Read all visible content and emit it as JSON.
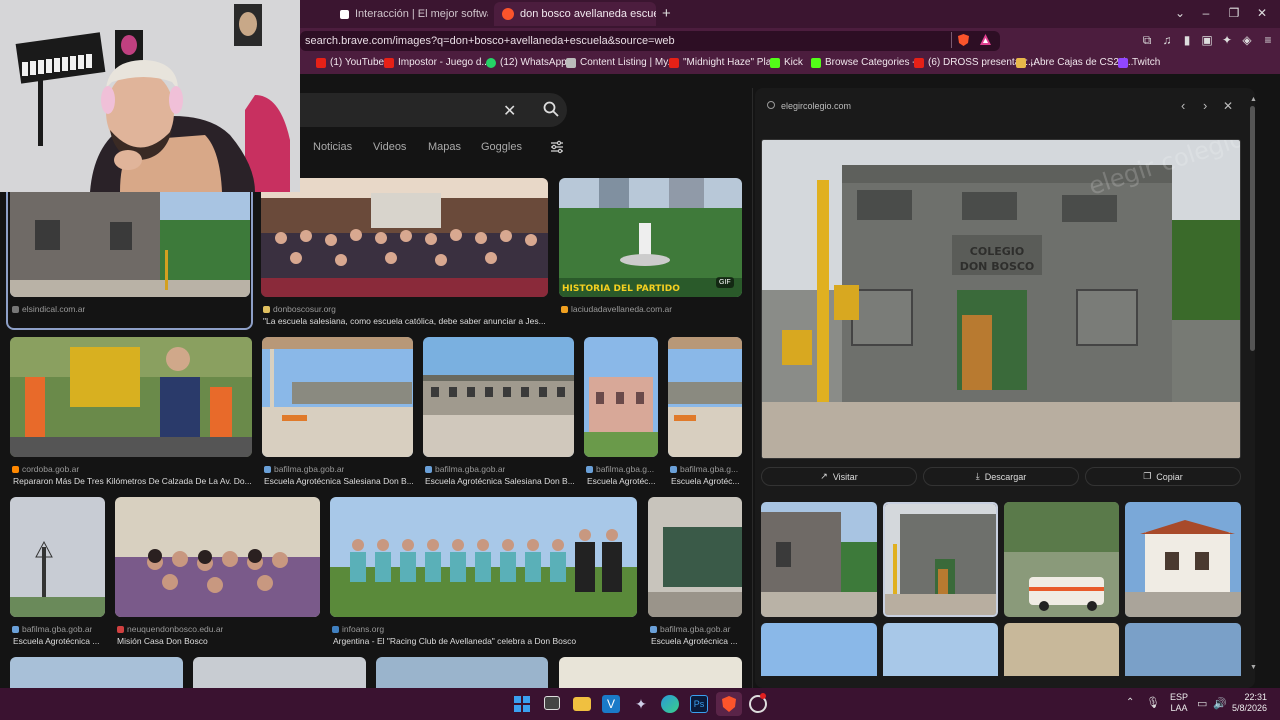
{
  "tabs": [
    {
      "title": "Interacción | El mejor software pa"
    },
    {
      "title": "don bosco avellaneda escuela - B"
    }
  ],
  "address": {
    "url": "search.brave.com/images?q=don+bosco+avellaneda+escuela&source=web"
  },
  "bookmarks": [
    {
      "label": "(1) YouTube",
      "color": "#e62117"
    },
    {
      "label": "Impostor - Juego d...",
      "color": "#e62117"
    },
    {
      "label": "(12) WhatsApp",
      "color": "#25d366"
    },
    {
      "label": "Content Listing | My...",
      "color": "#cccccc"
    },
    {
      "label": "\"Midnight Haze\" Pla...",
      "color": "#e62117"
    },
    {
      "label": "Kick",
      "color": "#53fc18"
    },
    {
      "label": "Browse Categories -...",
      "color": "#53fc18"
    },
    {
      "label": "(6) DROSS presentas:...",
      "color": "#e62117"
    },
    {
      "label": "¡Abre Cajas de CS2 (...",
      "color": "#e8b84a"
    },
    {
      "label": "Twitch",
      "color": "#9146ff"
    }
  ],
  "search": {
    "nav_tabs": [
      "Noticias",
      "Videos",
      "Mapas",
      "Goggles"
    ]
  },
  "results": [
    {
      "source": "elsindical.com.ar",
      "caption": "",
      "fav": "#888888"
    },
    {
      "source": "donboscosur.org",
      "caption": "\"La escuela salesiana, como escuela católica, debe saber anunciar a Jes...",
      "fav": "#e0c060"
    },
    {
      "source": "laciudadavellaneda.com.ar",
      "caption": "",
      "fav": "#f0a020",
      "badge": "GIF",
      "overlay": "HISTORIA DEL PARTIDO"
    },
    {
      "source": "cordoba.gob.ar",
      "caption": "Repararon Más De Tres Kilómetros De Calzada De La Av. Do...",
      "fav": "#ff8800"
    },
    {
      "source": "bafilma.gba.gob.ar",
      "caption": "Escuela Agrotécnica Salesiana Don B...",
      "fav": "#6aa0d8"
    },
    {
      "source": "bafilma.gba.gob.ar",
      "caption": "Escuela Agrotécnica Salesiana Don B...",
      "fav": "#6aa0d8"
    },
    {
      "source": "bafilma.gba.g...",
      "caption": "Escuela Agrotéc...",
      "fav": "#6aa0d8"
    },
    {
      "source": "bafilma.gba.g...",
      "caption": "Escuela Agrotéc...",
      "fav": "#6aa0d8"
    },
    {
      "source": "bafilma.gba.gob.ar",
      "caption": "Escuela Agrotécnica ...",
      "fav": "#6aa0d8"
    },
    {
      "source": "neuquendonbosco.edu.ar",
      "caption": "Misión Casa Don Bosco",
      "fav": "#d04040"
    },
    {
      "source": "infoans.org",
      "caption": "Argentina - El \"Racing Club de Avellaneda\" celebra a Don Bosco",
      "fav": "#4080c0"
    },
    {
      "source": "bafilma.gba.gob.ar",
      "caption": "Escuela Agrotécnica ...",
      "fav": "#6aa0d8"
    }
  ],
  "panel": {
    "domain": "elegircolegio.com",
    "sign": "COLEGIO DON BOSCO",
    "watermark": "elegir colegio",
    "visit": "Visitar",
    "download": "Descargar",
    "copy": "Copiar"
  },
  "taskbar": {
    "lang": "ESP",
    "lang2": "LAA",
    "time": "22:31",
    "date": "5/8/2026"
  },
  "colors": {
    "tabbar": "#3b1530",
    "toolbar": "#4c1d3e",
    "accent": "#fb542b"
  }
}
